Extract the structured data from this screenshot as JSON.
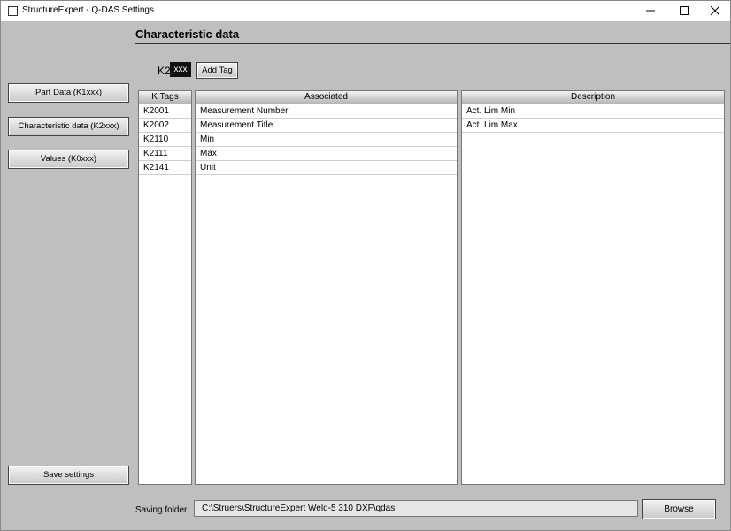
{
  "window": {
    "title": "StructureExpert - Q-DAS Settings"
  },
  "window_controls": [
    "minimize-icon",
    "maximize-icon",
    "close-icon"
  ],
  "header": {
    "title": "Characteristic data"
  },
  "tag_entry": {
    "prefix": "K2",
    "value": "xxx",
    "add_button_label": "Add Tag"
  },
  "sidebar": {
    "items": [
      {
        "label": "Part Data (K1xxx)"
      },
      {
        "label": "Characteristic data (K2xxx)"
      },
      {
        "label": "Values (K0xxx)"
      }
    ],
    "save_label": "Save settings"
  },
  "table": {
    "columns": {
      "ktags": "K Tags",
      "associated": "Associated",
      "description": "Description"
    },
    "ktags": [
      "K2001",
      "K2002",
      "K2110",
      "K2111",
      "K2141"
    ],
    "associated": [
      "Measurement Number",
      "Measurement Title",
      "Min",
      "Max",
      "Unit"
    ],
    "description": [
      "Act. Lim Min",
      "Act. Lim Max"
    ]
  },
  "footer": {
    "saving_folder_label": "Saving folder",
    "saving_folder_path": "C:\\Struers\\StructureExpert Weld-5 310 DXF\\qdas",
    "browse_label": "Browse"
  }
}
